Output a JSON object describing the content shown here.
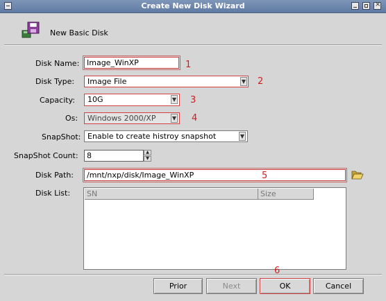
{
  "window": {
    "title": "Create New Disk Wizard"
  },
  "header": {
    "title": "New Basic Disk",
    "icon": "floppy-disk-icon"
  },
  "form": {
    "disk_name": {
      "label": "Disk Name:",
      "value": "Image_WinXP",
      "marker": "1"
    },
    "disk_type": {
      "label": "Disk Type:",
      "value": "Image File",
      "marker": "2"
    },
    "capacity": {
      "label": "Capacity:",
      "value": "10G",
      "marker": "3"
    },
    "os": {
      "label": "Os:",
      "value": "Windows 2000/XP",
      "marker": "4"
    },
    "snapshot": {
      "label": "SnapShot:",
      "value": "Enable to create histroy snapshot"
    },
    "snapshot_count": {
      "label": "SnapShot Count:",
      "value": "8"
    },
    "disk_path": {
      "label": "Disk Path:",
      "value": "/mnt/nxp/disk/Image_WinXP",
      "marker": "5",
      "browse_icon": "folder-open-icon"
    },
    "disk_list": {
      "label": "Disk List:",
      "columns": [
        "SN",
        "Size"
      ],
      "rows": []
    }
  },
  "buttons": {
    "prior": "Prior",
    "next": "Next",
    "ok": "OK",
    "cancel": "Cancel",
    "ok_marker": "6"
  },
  "colors": {
    "title_bar": "#6a84ad",
    "annotation": "#d11c1c",
    "dialog_bg": "#d6d6d6"
  }
}
